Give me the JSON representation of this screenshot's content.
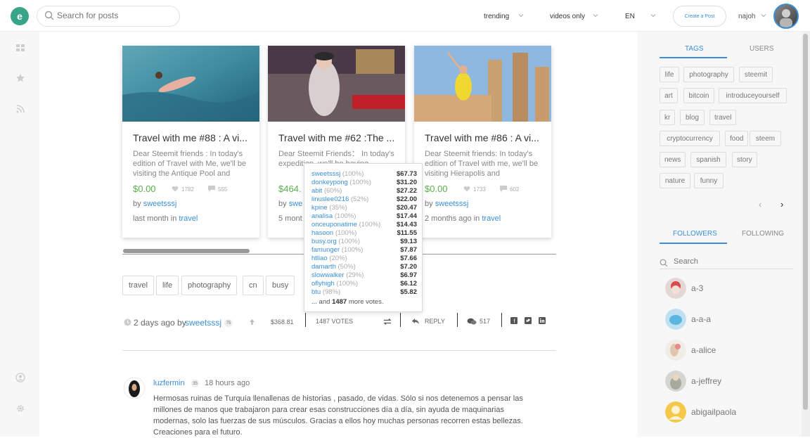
{
  "header": {
    "logo_letter": "e",
    "search_placeholder": "Search for posts",
    "sort_label": "trending",
    "filter_label": "videos only",
    "language_label": "EN",
    "create_button_label": "Create a Post",
    "username": "najoh"
  },
  "cards": [
    {
      "title": "Travel with me #88 : A vi...",
      "excerpt": "Dear Steemit friends : In today's edition of Travel with Me, we'll be visiting the Antique Pool and",
      "payout": "$0.00",
      "likes": "1782",
      "comments": "555",
      "by_prefix": "by ",
      "author": "sweetsssj",
      "time_prefix": "last month in ",
      "category": "travel"
    },
    {
      "title": "Travel with me #62 :The ...",
      "excerpt": "Dear Steemit Friends： In today's expedition, we'll be having",
      "payout": "$464.",
      "likes": "",
      "comments": "",
      "by_prefix": "by ",
      "author": "swe",
      "time_prefix": "5 mont",
      "category": ""
    },
    {
      "title": "Travel with me #86 : A vi...",
      "excerpt": "Dear Steemit friends: In today's edition of Travel with me, we'll be visiting Hierapolis and",
      "payout": "$0.00",
      "likes": "1733",
      "comments": "602",
      "by_prefix": "by ",
      "author": "sweetsssj",
      "time_prefix": "2 months ago in ",
      "category": "travel"
    }
  ],
  "post_tags": [
    "travel",
    "life",
    "photography",
    "cn",
    "busy"
  ],
  "post_stats": {
    "time": "2 days ago by",
    "author": "sweetsssj",
    "reputation": "75",
    "payout": "$368.81",
    "votes": "1487 VOTES",
    "reply_label": "REPLY",
    "comments": "517"
  },
  "votes_popup": {
    "voters": [
      {
        "name": "sweetsssj",
        "pct": "(100%)",
        "amount": "$67.73"
      },
      {
        "name": "donkeypong",
        "pct": "(100%)",
        "amount": "$31.20"
      },
      {
        "name": "abit",
        "pct": "(60%)",
        "amount": "$27.22"
      },
      {
        "name": "linuslee0216",
        "pct": "(52%)",
        "amount": "$22.00"
      },
      {
        "name": "kpine",
        "pct": "(35%)",
        "amount": "$20.47"
      },
      {
        "name": "analisa",
        "pct": "(100%)",
        "amount": "$17.44"
      },
      {
        "name": "onceuponatime",
        "pct": "(100%)",
        "amount": "$14.43"
      },
      {
        "name": "hasoon",
        "pct": "(100%)",
        "amount": "$11.55"
      },
      {
        "name": "busy.org",
        "pct": "(100%)",
        "amount": "$9.13"
      },
      {
        "name": "famunger",
        "pct": "(100%)",
        "amount": "$7.87"
      },
      {
        "name": "htliao",
        "pct": "(20%)",
        "amount": "$7.66"
      },
      {
        "name": "damarth",
        "pct": "(50%)",
        "amount": "$7.20"
      },
      {
        "name": "slowwalker",
        "pct": "(29%)",
        "amount": "$6.97"
      },
      {
        "name": "oflyhigh",
        "pct": "(100%)",
        "amount": "$6.12"
      },
      {
        "name": "btu",
        "pct": "(98%)",
        "amount": "$5.82"
      }
    ],
    "more_prefix": "... and ",
    "more_count": "1487",
    "more_suffix": " more votes."
  },
  "comment": {
    "author": "luzfermin",
    "reputation": "35",
    "time": "18 hours ago",
    "body": "Hermosas ruinas de Turquía llenallenas de historias , pasado, de vidas. Sólo si nos detenemos a pensar las millones de manos que trabajaron para crear esas construcciones día a día, sin ayuda de maquinarias modernas, solo las fuerzas de sus músculos. Gracias a ellos hoy muchas personas recorren estas bellezas. Creaciones para el futuro."
  },
  "right_sidebar": {
    "tab_tags": "TAGS",
    "tab_users": "USERS",
    "tags": [
      "life",
      "photography",
      "steemit",
      "art",
      "bitcoin",
      "introduceyourself",
      "kr",
      "blog",
      "travel",
      "cryptocurrency",
      "food",
      "steem",
      "news",
      "spanish",
      "story",
      "nature",
      "funny"
    ],
    "tab_followers": "FOLLOWERS",
    "tab_following": "FOLLOWING",
    "search_placeholder": "Search",
    "followers": [
      "a-3",
      "a-a-a",
      "a-alice",
      "a-jeffrey",
      "abigailpaola"
    ]
  },
  "colors": {
    "accent": "#3a8fd9",
    "brand": "#3aa48b",
    "payout": "#5ab04a"
  }
}
